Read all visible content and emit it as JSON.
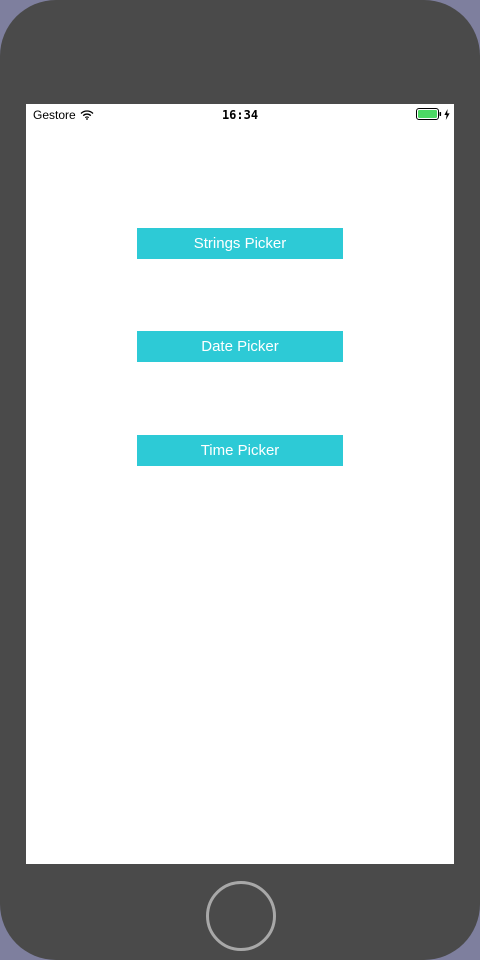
{
  "status_bar": {
    "carrier": "Gestore",
    "time": "16:34"
  },
  "buttons": {
    "strings_picker": "Strings Picker",
    "date_picker": "Date Picker",
    "time_picker": "Time Picker"
  },
  "colors": {
    "button_bg": "#2dcad6",
    "button_text": "#ffffff",
    "device_frame": "#4a4a4a",
    "battery_fill": "#4cd964"
  },
  "icons": {
    "wifi": "wifi-icon",
    "battery": "battery-icon",
    "charging": "charging-icon",
    "home": "home-button"
  }
}
